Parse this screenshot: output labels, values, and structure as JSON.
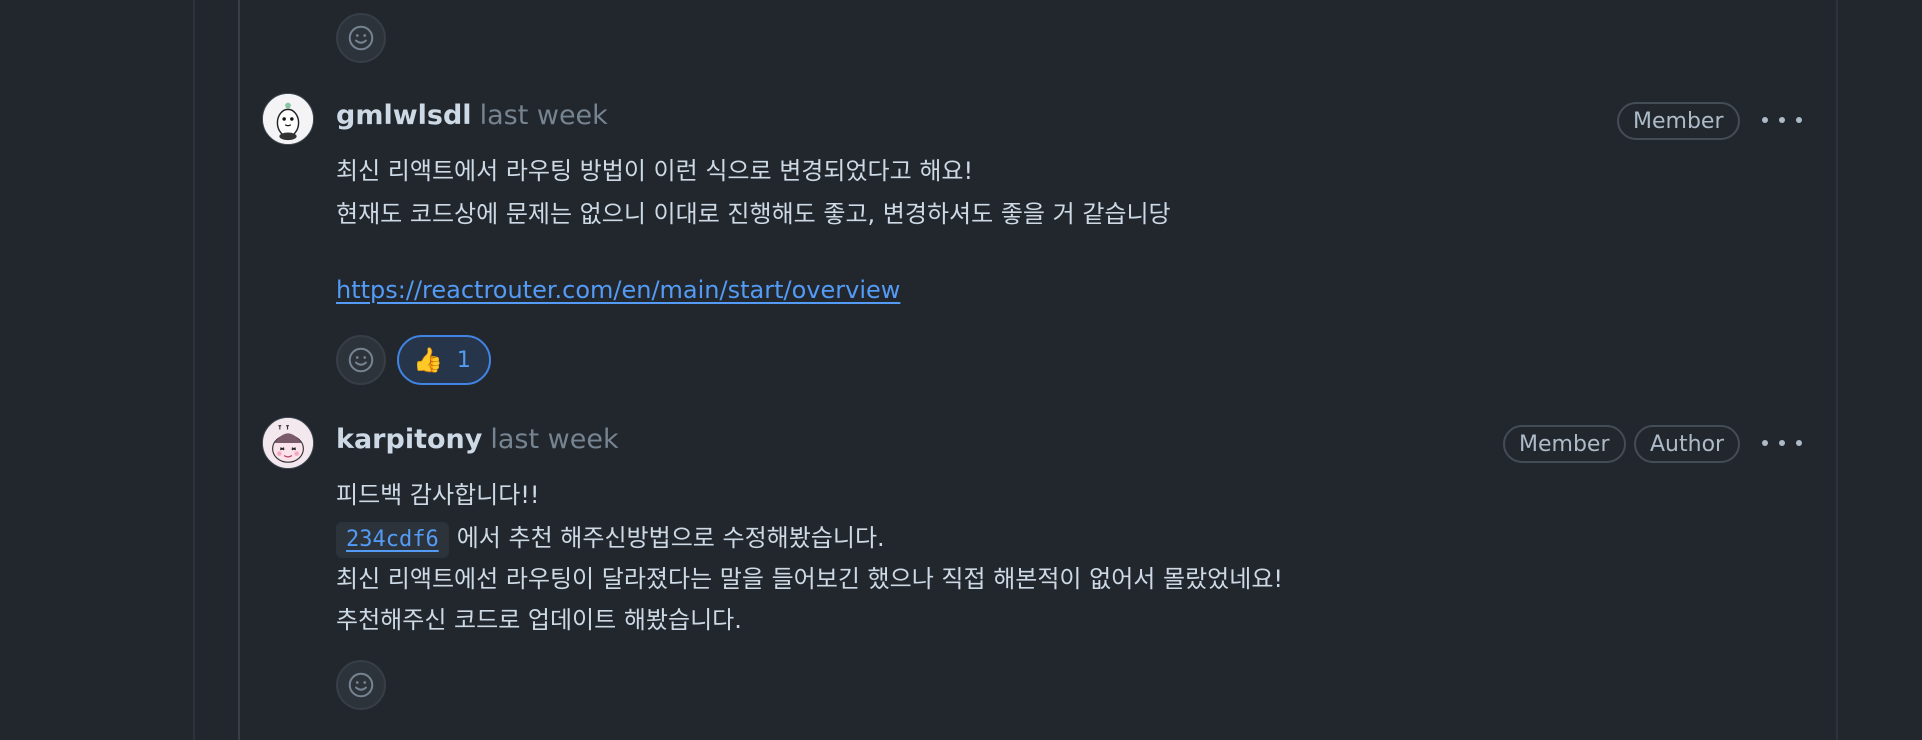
{
  "comments": [
    {
      "author": "gmlwlsdl",
      "timestamp": "last week",
      "badges": [
        "Member"
      ],
      "lines": [
        "최신 리액트에서 라우팅 방법이 이런 식으로 변경되었다고 해요!",
        "현재도 코드상에 문제는 없으니 이대로 진행해도 좋고, 변경하셔도 좋을 거 같습니당"
      ],
      "link": "https://reactrouter.com/en/main/start/overview",
      "reaction": {
        "emoji": "👍",
        "count": "1"
      }
    },
    {
      "author": "karpitony",
      "timestamp": "last week",
      "badges": [
        "Member",
        "Author"
      ],
      "line1": "피드백 감사합니다!!",
      "commit_sha": "234cdf6",
      "line2_suffix": "에서 추천 해주신방법으로 수정해봤습니다.",
      "line3": "최신 리액트에선 라우팅이 달라졌다는 말을 들어보긴 했으나 직접 해본적이 없어서 몰랐었네요!",
      "line4": "추천해주신 코드로 업데이트 해봤습니다."
    }
  ],
  "icons": {
    "reaction_picker": "smiley-icon",
    "menu": "kebab-horizontal-icon"
  },
  "colors": {
    "background": "#22272e",
    "link": "#539bf5",
    "reaction_border": "#4184e4"
  }
}
